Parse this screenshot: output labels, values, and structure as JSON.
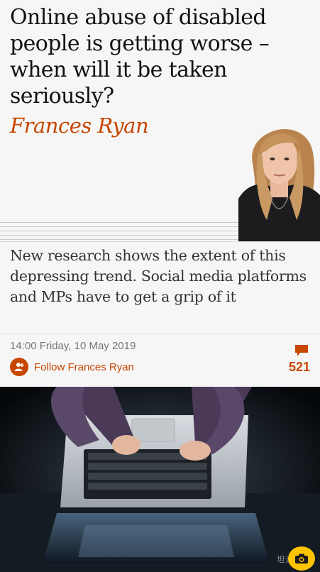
{
  "article": {
    "headline": "Online abuse of disabled people is getting worse – when will it be taken seriously?",
    "byline": "Frances Ryan",
    "standfirst": "New research shows the extent of this depressing trend. Social media platforms and MPs have to get a grip of it",
    "timestamp": "14:00 Friday, 10 May 2019",
    "follow_label": "Follow Frances Ryan",
    "comment_count": "521"
  },
  "watermark": "坦途◎网",
  "icons": {
    "follow": "add-user-icon",
    "comments": "comment-bubble-icon",
    "camera": "camera-icon"
  },
  "colors": {
    "accent": "#c74600",
    "background": "#f6f6f6",
    "headline": "#121212",
    "camera_button": "#ffc400"
  }
}
